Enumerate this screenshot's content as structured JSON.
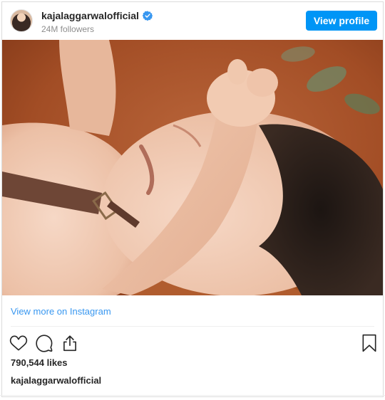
{
  "header": {
    "username": "kajalaggarwalofficial",
    "followers": "24M followers",
    "view_profile_label": "View profile",
    "avatar_icon": "profile-avatar",
    "verified_icon": "verified-badge-icon"
  },
  "post": {
    "view_more_label": "View more on Instagram",
    "likes": "790,544 likes",
    "caption_username": "kajalaggarwalofficial"
  },
  "icons": {
    "like": "heart-icon",
    "comment": "comment-icon",
    "share": "share-icon",
    "save": "bookmark-icon"
  },
  "colors": {
    "accent": "#0095f6",
    "link": "#3897f0",
    "text": "#262626",
    "muted": "#8e8e8e"
  }
}
